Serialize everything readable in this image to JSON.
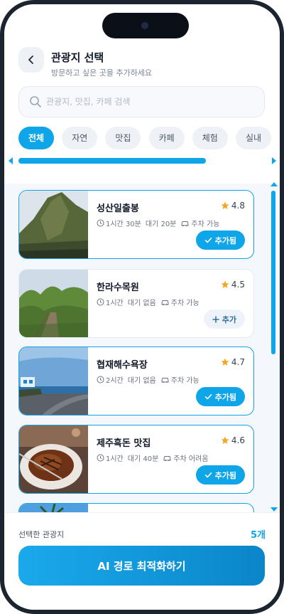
{
  "header": {
    "title": "관광지 선택",
    "subtitle": "방문하고 싶은 곳을 추가하세요",
    "back_icon": "chevron-left-icon"
  },
  "search": {
    "placeholder": "관광지, 맛집, 카페 검색",
    "value": ""
  },
  "filters": [
    {
      "label": "전체",
      "active": true
    },
    {
      "label": "자연",
      "active": false
    },
    {
      "label": "맛집",
      "active": false
    },
    {
      "label": "카페",
      "active": false
    },
    {
      "label": "체험",
      "active": false
    },
    {
      "label": "실내",
      "active": false
    }
  ],
  "places": [
    {
      "name": "성산일출봉",
      "rating": "4.8",
      "duration": "1시간 30분",
      "wait": "대기 20분",
      "parking": "주차 가능",
      "action": "추가됨",
      "added": true,
      "image": "sea-cliff-photo"
    },
    {
      "name": "한라수목원",
      "rating": "4.5",
      "duration": "1시간",
      "wait": "대기 없음",
      "parking": "주차 가능",
      "action": "추가",
      "added": false,
      "image": "forest-path-photo"
    },
    {
      "name": "협재해수욕장",
      "rating": "4.7",
      "duration": "2시간",
      "wait": "대기 없음",
      "parking": "주차 가능",
      "action": "추가됨",
      "added": true,
      "image": "coastal-road-photo"
    },
    {
      "name": "제주흑돈 맛집",
      "rating": "4.6",
      "duration": "1시간",
      "wait": "대기 40분",
      "parking": "주차 어려움",
      "action": "추가됨",
      "added": true,
      "image": "food-plate-photo"
    }
  ],
  "footer": {
    "selected_label": "선택한 관광지",
    "selected_count": "5개",
    "cta_label": "AI 경로 최적화하기"
  },
  "colors": {
    "accent": "#0ea5e9",
    "accent_dark": "#0a86c9",
    "star": "#f5a623"
  }
}
